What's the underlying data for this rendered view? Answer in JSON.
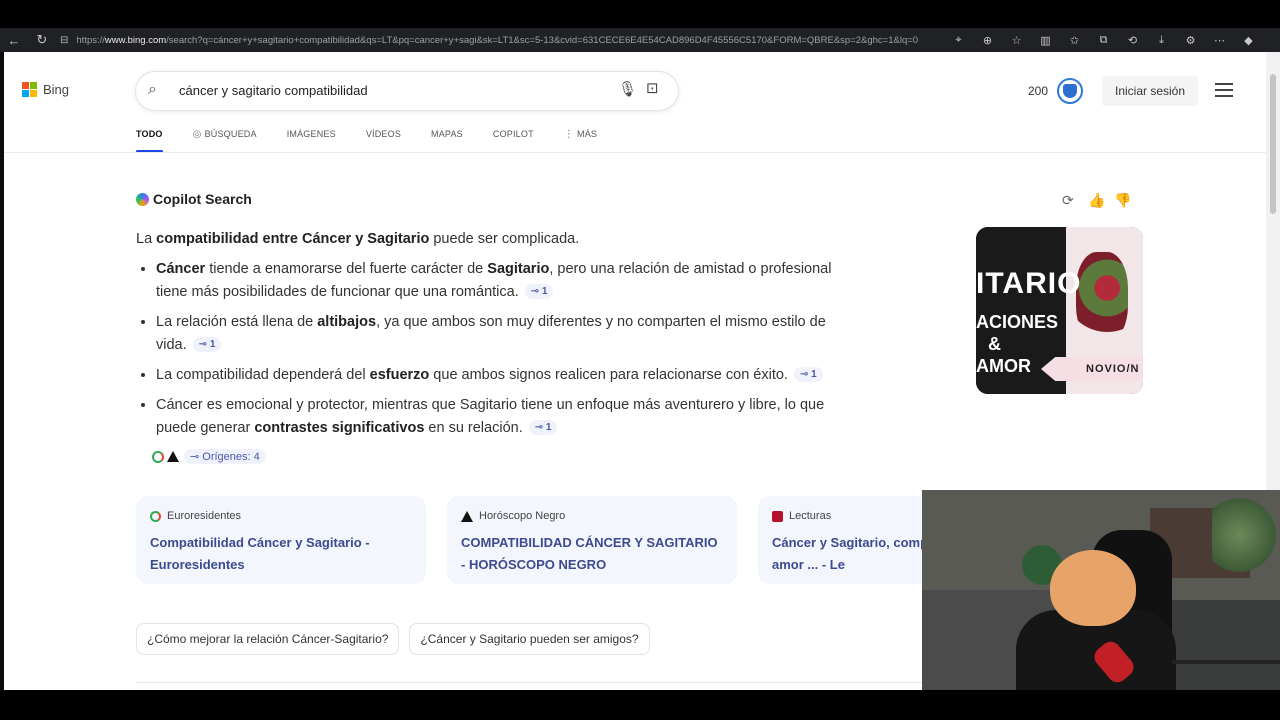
{
  "browser": {
    "url_prefix": "https://",
    "url_domain": "www.bing.com",
    "url_path": "/search?q=cáncer+y+sagitario+compatibilidad&qs=LT&pq=cancer+y+sagi&sk=LT1&sc=5-13&cvid=631CECE6E4E54CAD896D4F45556C5170&FORM=QBRE&sp=2&ghc=1&lq=0"
  },
  "header": {
    "logo_text": "Bing",
    "search_query": "cáncer y sagitario compatibilidad",
    "points": "200",
    "signin_label": "Iniciar sesión"
  },
  "tabs": [
    {
      "label": "TODO"
    },
    {
      "label": "BÚSQUEDA"
    },
    {
      "label": "IMÁGENES"
    },
    {
      "label": "VÍDEOS"
    },
    {
      "label": "MAPAS"
    },
    {
      "label": "COPILOT"
    },
    {
      "label": "MÁS"
    }
  ],
  "copilot": {
    "title": "Copilot Search",
    "intro_pre": "La ",
    "intro_bold": "compatibilidad entre Cáncer y Sagitario",
    "intro_post": " puede ser complicada.",
    "bullets": [
      {
        "bold1": "Cáncer",
        "text1": " tiende a enamorarse del fuerte carácter de ",
        "bold2": "Sagitario",
        "text2": ", pero una relación de amistad o profesional tiene más posibilidades de funcionar que una romántica.",
        "cite": "1"
      },
      {
        "text1": "La relación está llena de ",
        "bold1": "altibajos",
        "text2": ", ya que ambos son muy diferentes y no comparten el mismo estilo de vida.",
        "cite": "1"
      },
      {
        "text1": "La compatibilidad dependerá del ",
        "bold1": "esfuerzo",
        "text2": " que ambos signos realicen para relacionarse con éxito.",
        "cite": "1"
      },
      {
        "text1": "Cáncer es emocional y protector, mientras que Sagitario tiene un enfoque más aventurero y libre, lo que puede generar ",
        "bold1": "contrastes significativos",
        "text2": " en su relación.",
        "cite": "1"
      }
    ],
    "origins_label": "Orígenes: 4"
  },
  "image": {
    "line1": "ITARIO",
    "line2": "ACIONES",
    "line3": "&",
    "line4": "AMOR",
    "band": "NOVIO/N"
  },
  "sources": [
    {
      "name": "Euroresidentes",
      "title": "Compatibilidad Cáncer y Sagitario - Euroresidentes",
      "color": "#2fa84f"
    },
    {
      "name": "Horóscopo Negro",
      "title": "COMPATIBILIDAD CÁNCER Y SAGITARIO - HORÓSCOPO NEGRO",
      "color": "#111111"
    },
    {
      "name": "Lecturas",
      "title": "Cáncer y Sagitario, comp signos en el amor ... - Le",
      "color": "#b3122a"
    }
  ],
  "related": [
    "¿Cómo mejorar la relación Cáncer-Sagitario?",
    "¿Cáncer y Sagitario pueden ser amigos?"
  ],
  "colors": {
    "accent": "#174ae4",
    "link": "#3c4a8f"
  }
}
